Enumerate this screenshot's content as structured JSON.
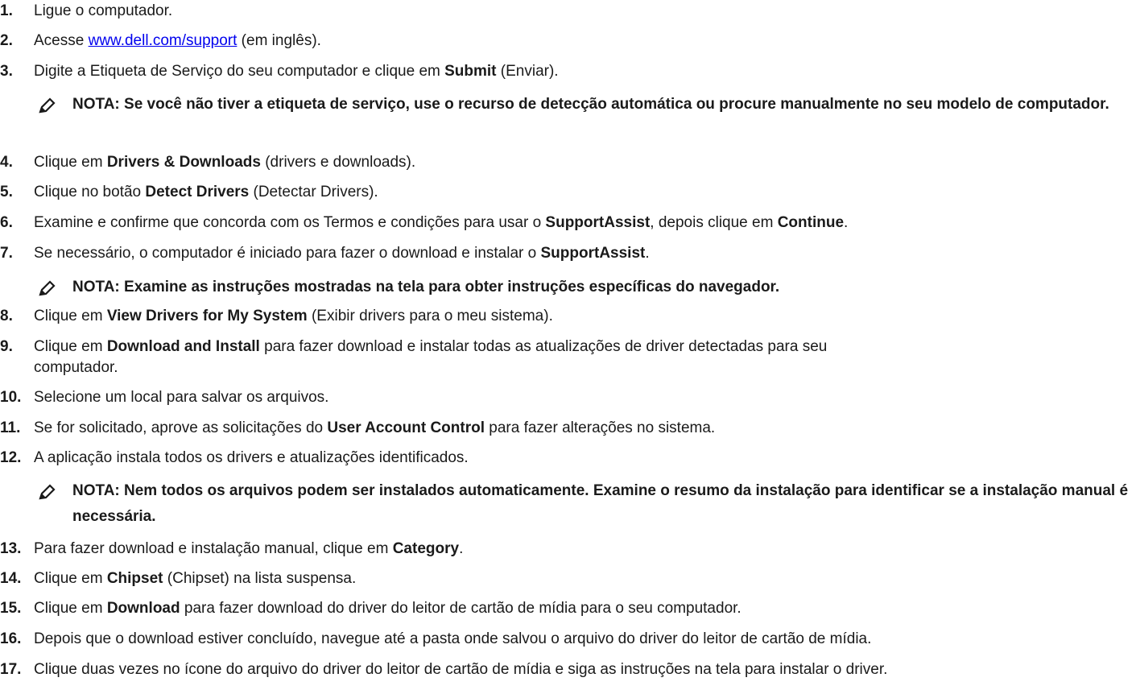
{
  "steps": [
    {
      "num": "1.",
      "text": "Ligue o computador."
    },
    {
      "num": "2.",
      "pre": "Acesse ",
      "link": "www.dell.com/support",
      "post": " (em inglês)."
    },
    {
      "num": "3.",
      "pre": "Digite a Etiqueta de Serviço do seu computador e clique em ",
      "bold": "Submit",
      "post": " (Enviar)."
    },
    {
      "num": "4.",
      "pre": "Clique em ",
      "bold": "Drivers & Downloads",
      "post": " (drivers e downloads)."
    },
    {
      "num": "5.",
      "pre": "Clique no botão ",
      "bold": "Detect Drivers",
      "post": " (Detectar Drivers)."
    },
    {
      "num": "6.",
      "pre": "Examine e confirme que concorda com os Termos e condições para usar o ",
      "bold": "SupportAssist",
      "mid": ", depois clique em ",
      "bold2": "Continue",
      "post": "."
    },
    {
      "num": "7.",
      "pre": "Se necessário, o computador é iniciado para fazer o download e instalar o ",
      "bold": "SupportAssist",
      "post": "."
    },
    {
      "num": "8.",
      "pre": "Clique em ",
      "bold": "View Drivers for My System",
      "post": " (Exibir drivers para o meu sistema)."
    },
    {
      "num": "9.",
      "pre": "Clique em ",
      "bold": "Download and Install",
      "post": " para fazer download e instalar todas as atualizações de driver detectadas para seu",
      "cont": "computador."
    },
    {
      "num": "10.",
      "text": "Selecione um local para salvar os arquivos."
    },
    {
      "num": "11.",
      "pre": "Se for solicitado, aprove as solicitações do ",
      "bold": "User Account Control",
      "post": " para fazer alterações no sistema."
    },
    {
      "num": "12.",
      "text": "A aplicação instala todos os drivers e atualizações identificados."
    },
    {
      "num": "13.",
      "pre": "Para fazer download e instalação manual, clique em ",
      "bold": "Category",
      "post": "."
    },
    {
      "num": "14.",
      "pre": "Clique em ",
      "bold": "Chipset",
      "post": " (Chipset) na lista suspensa."
    },
    {
      "num": "15.",
      "pre": "Clique em ",
      "bold": "Download",
      "post": " para fazer download do driver do leitor de cartão de mídia para o seu computador."
    },
    {
      "num": "16.",
      "text": "Depois que o download estiver concluído, navegue até a pasta onde salvou o arquivo do driver do leitor de cartão de mídia."
    },
    {
      "num": "17.",
      "text": "Clique duas vezes no ícone do arquivo do driver do leitor de cartão de mídia e siga as instruções na tela para instalar o driver."
    }
  ],
  "notes": [
    {
      "icon": "note-pencil-icon",
      "text": "NOTA: Se você não tiver a etiqueta de serviço, use o recurso de detecção automática ou procure manualmente no seu modelo de computador."
    },
    {
      "icon": "note-pencil-icon",
      "text": "NOTA: Examine as instruções mostradas na tela para obter instruções específicas do navegador."
    },
    {
      "icon": "note-pencil-icon",
      "text": "NOTA: Nem todos os arquivos podem ser instalados automaticamente. Examine o resumo da instalação para identificar se a instalação manual é necessária."
    }
  ]
}
